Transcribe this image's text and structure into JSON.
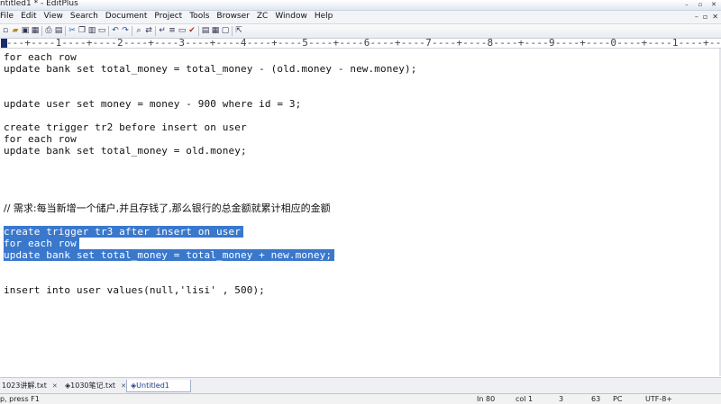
{
  "window": {
    "title": "ntitled1 * - EditPlus",
    "controls": [
      "–",
      "▫",
      "✕"
    ]
  },
  "menu": {
    "items": [
      "File",
      "Edit",
      "View",
      "Search",
      "Document",
      "Project",
      "Tools",
      "Browser",
      "ZC",
      "Window",
      "Help"
    ],
    "mdi_controls": [
      "–",
      "▫",
      "✕"
    ]
  },
  "toolbar": {
    "icons": [
      "new-file-icon",
      "open-file-icon",
      "save-icon",
      "save-all-icon",
      "print-icon",
      "print-preview-icon",
      "cut-icon",
      "copy-icon",
      "paste-icon",
      "delete-icon",
      "undo-icon",
      "redo-icon",
      "find-icon",
      "replace-icon",
      "word-wrap-icon",
      "line-number-icon",
      "ruler-icon",
      "spell-check-icon",
      "cliptext-icon",
      "directory-icon",
      "output-icon",
      "help-icon"
    ]
  },
  "ruler": {
    "text": "----+----1----+----2----+----3----+----4----+----5----+----6----+----7----+----8----+----9----+----0----+----1----+----2"
  },
  "editor": {
    "lines": [
      "for each row",
      "update bank set total_money = total_money - (old.money - new.money);",
      "",
      "",
      "update user set money = money - 900 where id = 3;",
      "",
      "create trigger tr2 before insert on user",
      "for each row",
      "update bank set total_money = old.money;",
      "",
      "",
      "",
      "",
      "// 需求:每当新增一个储户,并且存钱了,那么银行的总金额就累计相应的金额",
      "",
      "create trigger tr3 after insert on user",
      "for each row",
      "update bank set total_money = total_money + new.money;",
      "",
      "",
      "insert into user values(null,'lisi' , 500);"
    ]
  },
  "tabs": [
    {
      "label": "1023讲解.txt"
    },
    {
      "label": "1030笔记.txt"
    },
    {
      "label": "Untitled1"
    }
  ],
  "status": {
    "hint": "p, press F1",
    "ln": "In 80",
    "col": "col 1",
    "n1": "3",
    "n2": "63",
    "mode": "PC",
    "encoding": "UTF-8+"
  },
  "colors": {
    "selection": "#3a78cc",
    "ruler_cursor": "#1a2a70",
    "active_tab": "#1b3e86"
  }
}
